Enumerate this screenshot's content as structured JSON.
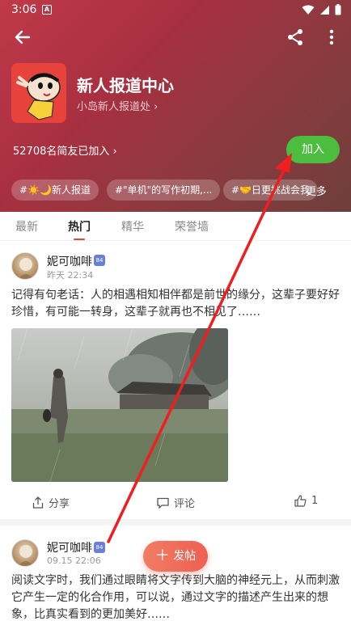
{
  "status_bar": {
    "time": "3:06"
  },
  "header": {
    "group_name": "新人报道中心",
    "group_subtitle": "小岛新人报道处 ›",
    "members_text": "52708名简友已加入 ›",
    "join_label": "加入",
    "tags": [
      "#☀️🌙新人报道",
      "#\"单机\"的写作初期,...",
      "#🤝日更挑战会我"
    ],
    "tags_more": "更多"
  },
  "tabs": [
    {
      "label": "最新",
      "active": false
    },
    {
      "label": "热门",
      "active": true
    },
    {
      "label": "精华",
      "active": false
    },
    {
      "label": "荣誉墙",
      "active": false
    }
  ],
  "posts": [
    {
      "author": "妮可咖啡",
      "level": "84",
      "time": "昨天 22:34",
      "content": "记得有句老话：人的相遇相知相伴都是前世的缘分，这辈子要好好珍惜，有可能一转身，这辈子就再也不相见了……",
      "actions": {
        "share": "分享",
        "comment": "评论",
        "like_count": "1"
      }
    },
    {
      "author": "妮可咖啡",
      "level": "84",
      "time": "09.15 22:06",
      "content": "阅读文字时，我们通过眼睛将文字传到大脑的神经元上，从而刺激它产生一定的化合作用，可以说，通过文字的描述产生出来的想象，比真实看到的更加美好……"
    }
  ],
  "fab": {
    "label": "发帖"
  },
  "colors": {
    "accent": "#e6453c",
    "join": "#4cbd3f",
    "annotation_arrow": "#f01e1e"
  }
}
